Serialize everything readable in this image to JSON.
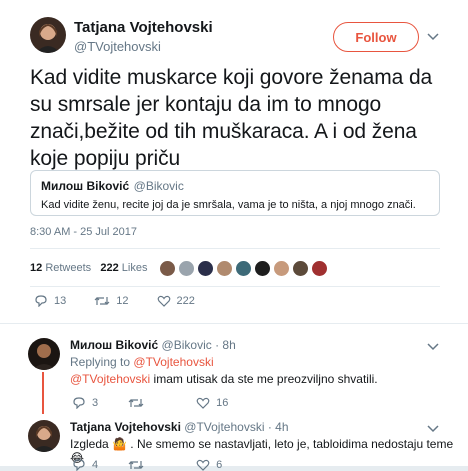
{
  "tweet": {
    "author_name": "Tatjana Vojtehovski",
    "author_handle": "@TVojtehovski",
    "follow_label": "Follow",
    "text": "Kad vidite muskarce koji govore ženama da su smrsale jer kontaju da im to mnogo znači,bežite od tih muškaraca. A i od žena koje popiju priču",
    "quote": {
      "name": "Милош Biković",
      "handle": "@Bikovic",
      "text": "Kad vidite ženu, recite joj da je smršala, vama je to ništa, a njoj mnogo znači."
    },
    "timestamp": "8:30 AM - 25 Jul 2017",
    "retweets_count": "12",
    "retweets_label": "Retweets",
    "likes_count": "222",
    "likes_label": "Likes",
    "actions": {
      "replies": "13",
      "retweets": "12",
      "likes": "222"
    }
  },
  "replies": [
    {
      "name": "Милош Biković",
      "handle": "@Bikovic",
      "time": "· 8h",
      "replying_prefix": "Replying to",
      "replying_to": "@TVojtehovski",
      "mention": "@TVojtehovski",
      "text": " imam utisak da ste me preozviljno shvatili.",
      "actions": {
        "replies": "3",
        "retweets": "",
        "likes": "16"
      }
    },
    {
      "name": "Tatjana Vojtehovski",
      "handle": "@TVojtehovski",
      "time": "· 4h",
      "text": "Izgleda 🤷 . Ne smemo se nastavljati, leto je, tabloidima nedostaju teme 😂",
      "actions": {
        "replies": "4",
        "retweets": "",
        "likes": "6"
      }
    }
  ],
  "colors": {
    "accent": "#e8553f",
    "muted": "#657786",
    "border": "#e6ecf0"
  }
}
